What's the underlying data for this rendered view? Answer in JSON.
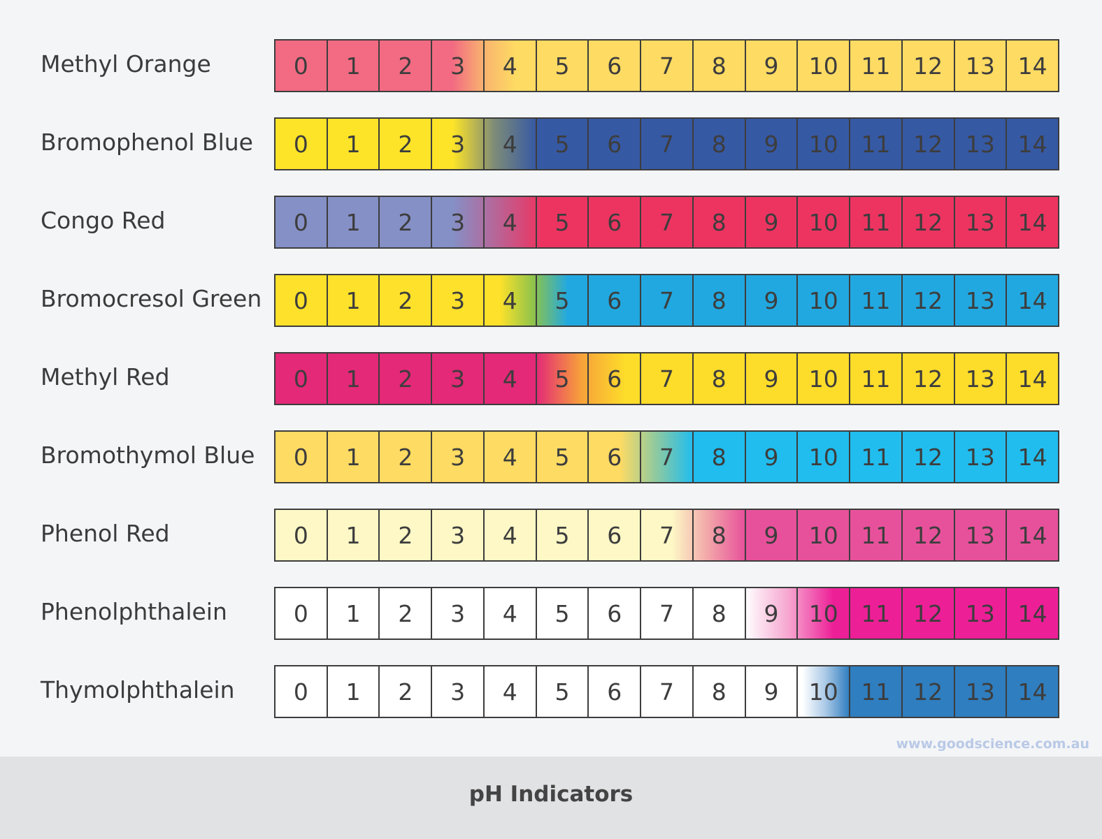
{
  "ph_values": [
    "0",
    "1",
    "2",
    "3",
    "4",
    "5",
    "6",
    "7",
    "8",
    "9",
    "10",
    "11",
    "12",
    "13",
    "14"
  ],
  "indicators": [
    {
      "name": "Methyl Orange",
      "acid_color": "#f26b82",
      "mid_color": "#f9b46e",
      "base_color": "#fedb63",
      "transition_ph": [
        2.9,
        4.1
      ]
    },
    {
      "name": "Bromophenol Blue",
      "acid_color": "#fde428",
      "mid_color": "#7d8b78",
      "base_color": "#3659a4",
      "transition_ph": [
        2.9,
        4.5
      ]
    },
    {
      "name": "Congo Red",
      "acid_color": "#8590c6",
      "mid_color": "#b96496",
      "base_color": "#ed3461",
      "transition_ph": [
        2.9,
        4.6
      ]
    },
    {
      "name": "Bromocresol Green",
      "acid_color": "#fde12a",
      "mid_color": "#8dc34b",
      "base_color": "#22a8e0",
      "transition_ph": [
        3.8,
        5.1
      ]
    },
    {
      "name": "Methyl Red",
      "acid_color": "#e32977",
      "mid_color": "#f7a03a",
      "base_color": "#fddc2a",
      "transition_ph": [
        4.5,
        6.2
      ]
    },
    {
      "name": "Bromothymol Blue",
      "acid_color": "#fedb63",
      "mid_color": "#8ec9a0",
      "base_color": "#21bdee",
      "transition_ph": [
        6.1,
        7.5
      ]
    },
    {
      "name": "Phenol Red",
      "acid_color": "#fdf8c6",
      "mid_color": "#f2a5a9",
      "base_color": "#e7519b",
      "transition_ph": [
        7.1,
        8.5
      ]
    },
    {
      "name": "Phenolphthalein",
      "acid_color": "#ffffff",
      "mid_color": "#f6a4cf",
      "base_color": "#ed1f97",
      "transition_ph": [
        8.5,
        10.2
      ]
    },
    {
      "name": "Thymolphthalein",
      "acid_color": "#ffffff",
      "mid_color": "#a9c8e6",
      "base_color": "#2f7ec0",
      "transition_ph": [
        9.6,
        10.5
      ]
    }
  ],
  "watermark": "www.goodscience.com.au",
  "footer": {
    "title": "pH Indicators"
  }
}
